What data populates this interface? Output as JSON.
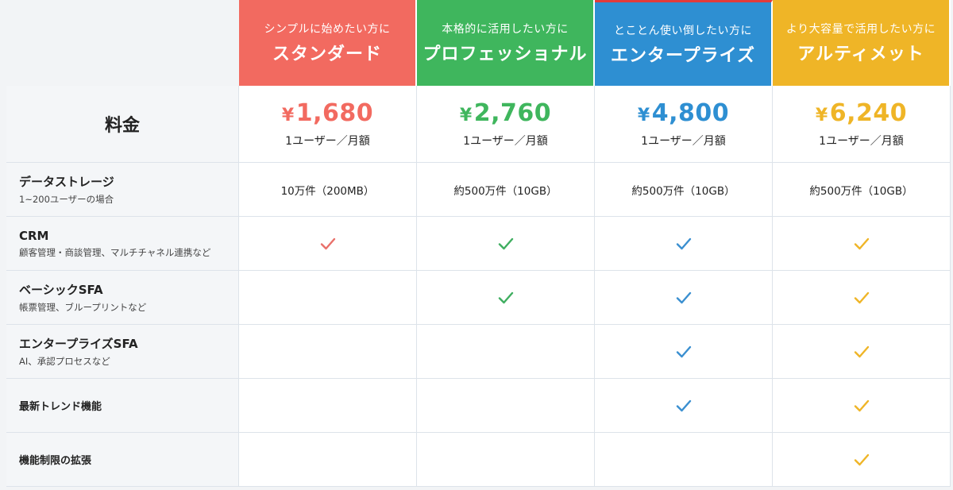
{
  "colors": {
    "standard": "#f26a60",
    "professional": "#3fb65d",
    "enterprise": "#2e8fd2",
    "ultimate": "#efb527",
    "check_standard": "#e9706a",
    "check_professional": "#3fae60",
    "check_enterprise": "#3a8fd0",
    "check_ultimate": "#efb527"
  },
  "plans": [
    {
      "subtitle": "シンプルに始めたい方に",
      "name": "スタンダード",
      "price": "1,680",
      "currency": "¥",
      "unit": "1ユーザー／月額"
    },
    {
      "subtitle": "本格的に活用したい方に",
      "name": "プロフェッショナル",
      "price": "2,760",
      "currency": "¥",
      "unit": "1ユーザー／月額"
    },
    {
      "subtitle": "とことん使い倒したい方に",
      "name": "エンタープライズ",
      "price": "4,800",
      "currency": "¥",
      "unit": "1ユーザー／月額"
    },
    {
      "subtitle": "より大容量で活用したい方に",
      "name": "アルティメット",
      "price": "6,240",
      "currency": "¥",
      "unit": "1ユーザー／月額"
    }
  ],
  "price_row": {
    "label": "料金"
  },
  "rows": [
    {
      "label": "データストレージ",
      "sub": "1~200ユーザーの場合",
      "values": [
        "10万件（200MB）",
        "約500万件（10GB）",
        "約500万件（10GB）",
        "約500万件（10GB）"
      ]
    },
    {
      "label": "CRM",
      "sub": "顧客管理・商談管理、マルチチャネル連携など",
      "checks": [
        true,
        true,
        true,
        true
      ]
    },
    {
      "label": "ベーシックSFA",
      "sub": "帳票管理、ブループリントなど",
      "checks": [
        false,
        true,
        true,
        true
      ]
    },
    {
      "label": "エンタープライズSFA",
      "sub": "AI、承認プロセスなど",
      "checks": [
        false,
        false,
        true,
        true
      ]
    },
    {
      "label": "最新トレンド機能",
      "sub": "",
      "checks": [
        false,
        false,
        true,
        true
      ]
    },
    {
      "label": "機能制限の拡張",
      "sub": "",
      "checks": [
        false,
        false,
        false,
        true
      ]
    }
  ]
}
